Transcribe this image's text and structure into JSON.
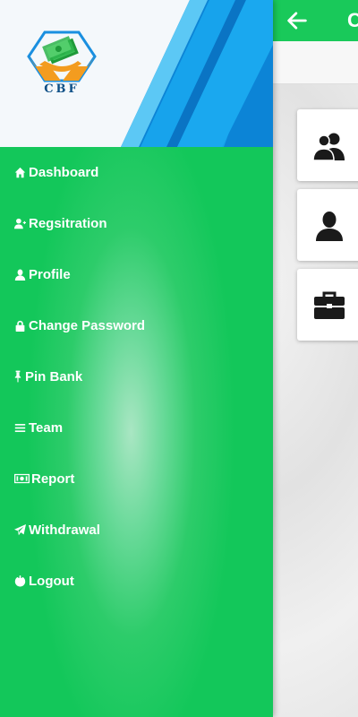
{
  "app": {
    "logo_text": "CBF",
    "title_partial": "C"
  },
  "colors": {
    "primary_green": "#19c95a",
    "header_bg": "#f4f8fb",
    "stripe_blue": "#1aa3e6",
    "logo_blue": "#0d4f86",
    "logo_orange": "#f39c1f"
  },
  "menu": {
    "items": [
      {
        "label": "Dashboard",
        "icon": "home-icon"
      },
      {
        "label": "Regsitration",
        "icon": "add-user-icon"
      },
      {
        "label": "Profile",
        "icon": "user-icon"
      },
      {
        "label": "Change Password",
        "icon": "lock-icon"
      },
      {
        "label": "Pin Bank",
        "icon": "pin-icon"
      },
      {
        "label": "Team",
        "icon": "list-icon"
      },
      {
        "label": "Report",
        "icon": "money-icon"
      },
      {
        "label": "Withdrawal",
        "icon": "send-icon"
      },
      {
        "label": "Logout",
        "icon": "power-icon"
      }
    ]
  },
  "tiles": [
    {
      "icon": "users-icon"
    },
    {
      "icon": "user-icon"
    },
    {
      "icon": "briefcase-icon"
    }
  ]
}
